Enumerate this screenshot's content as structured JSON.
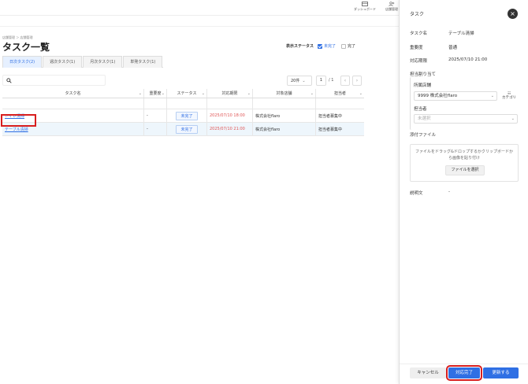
{
  "topnav": {
    "dashboard": {
      "label": "ダッシュボード",
      "icon": "dashboard-icon"
    },
    "store_management": {
      "label": "店舗管理",
      "icon": "users-icon"
    }
  },
  "breadcrumb": "店舗管理 ＞ 店舗管理",
  "page_title": "タスク一覧",
  "status_filter": {
    "label": "表示ステータス",
    "options": [
      {
        "label": "未完了",
        "checked": true
      },
      {
        "label": "完了",
        "checked": false
      }
    ]
  },
  "tabs": [
    {
      "label": "日次タスク(2)",
      "active": true
    },
    {
      "label": "週次タスク(1)",
      "active": false
    },
    {
      "label": "月次タスク(1)",
      "active": false
    },
    {
      "label": "単発タスク(1)",
      "active": false
    }
  ],
  "search": {
    "placeholder": "",
    "icon": "search-icon"
  },
  "pagination": {
    "per_page": "20件",
    "page": "1",
    "total": "/ 1",
    "prev": "‹",
    "next": "›"
  },
  "table": {
    "columns": [
      "タスク名",
      "重要度",
      "ステータス",
      "対応期限",
      "対象店舗",
      "担当者"
    ],
    "rows": [
      {
        "name": "トイレ清掃",
        "importance": "-",
        "status": "未完了",
        "due": "2025/07/10 18:00",
        "store": "株式会社flaro",
        "assignee": "担当者募集中"
      },
      {
        "name": "テーブル清掃",
        "importance": "-",
        "status": "未完了",
        "due": "2025/07/10 21:00",
        "store": "株式会社flaro",
        "assignee": "担当者募集中"
      }
    ]
  },
  "panel": {
    "title": "タスク",
    "close": "×",
    "task_name_label": "タスク名",
    "task_name": "テーブル清掃",
    "importance_label": "重要度",
    "importance": "普通",
    "due_label": "対応期限",
    "due": "2025/07/10 21:00",
    "assign_label": "担当割り当て",
    "store_label": "所属店舗",
    "store_value": "9999 株式会社flaro",
    "category_label": "カテゴリ",
    "assignee_label": "担当者",
    "assignee_placeholder": "未選択",
    "attachment_label": "添付ファイル",
    "drop_text": "ファイルをドラッグ&ドロップするかクリップボードから画像を貼り付け",
    "file_button": "ファイルを選択",
    "description_label": "説明文",
    "description": "-",
    "cancel": "キャンセル",
    "complete": "対応完了",
    "update": "更新する"
  },
  "colors": {
    "accent": "#2f6fe4",
    "highlight": "#d81e1e",
    "due": "#e05555"
  }
}
